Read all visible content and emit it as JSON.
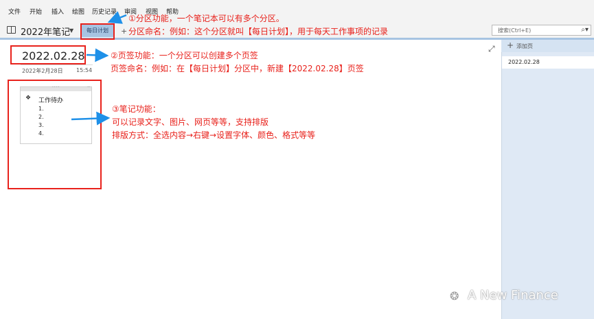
{
  "menu": {
    "items": [
      "文件",
      "开始",
      "插入",
      "绘图",
      "历史记录",
      "审阅",
      "视图",
      "帮助"
    ]
  },
  "notebook": {
    "title": "2022年笔记"
  },
  "section_tab": {
    "label": "每日计划",
    "add_symbol": "+"
  },
  "search": {
    "placeholder": "搜索(Ctrl+E)"
  },
  "page": {
    "title": "2022.02.28",
    "date": "2022年2月28日",
    "time": "15:54"
  },
  "note": {
    "heading": "工作待办",
    "items": [
      "1.",
      "2.",
      "3.",
      "4."
    ]
  },
  "page_list": {
    "add_label": "添加页",
    "items": [
      "2022.02.28"
    ]
  },
  "annotations": {
    "section_line1": "①分区功能，一个笔记本可以有多个分区。",
    "section_line2": "分区命名：例如：这个分区就叫【每日计划】，用于每天工作事项的记录",
    "page_line1": "②页签功能：一个分区可以创建多个页签",
    "page_line2": "页签命名：例如：在【每日计划】分区中，新建【2022.02.28】页签",
    "note_line1": "③笔记功能：",
    "note_line2": "可以记录文字、图片、网页等等，支持排版",
    "note_line3": "排版方式：全选内容→右键→设置字体、颜色、格式等等"
  },
  "watermark": {
    "text": "A New Finance"
  },
  "colors": {
    "annotation_red": "#e8211b",
    "arrow_blue": "#1e90e8",
    "section_tab_bg": "#a7c4e2",
    "page_panel_bg": "#dfe9f5"
  }
}
